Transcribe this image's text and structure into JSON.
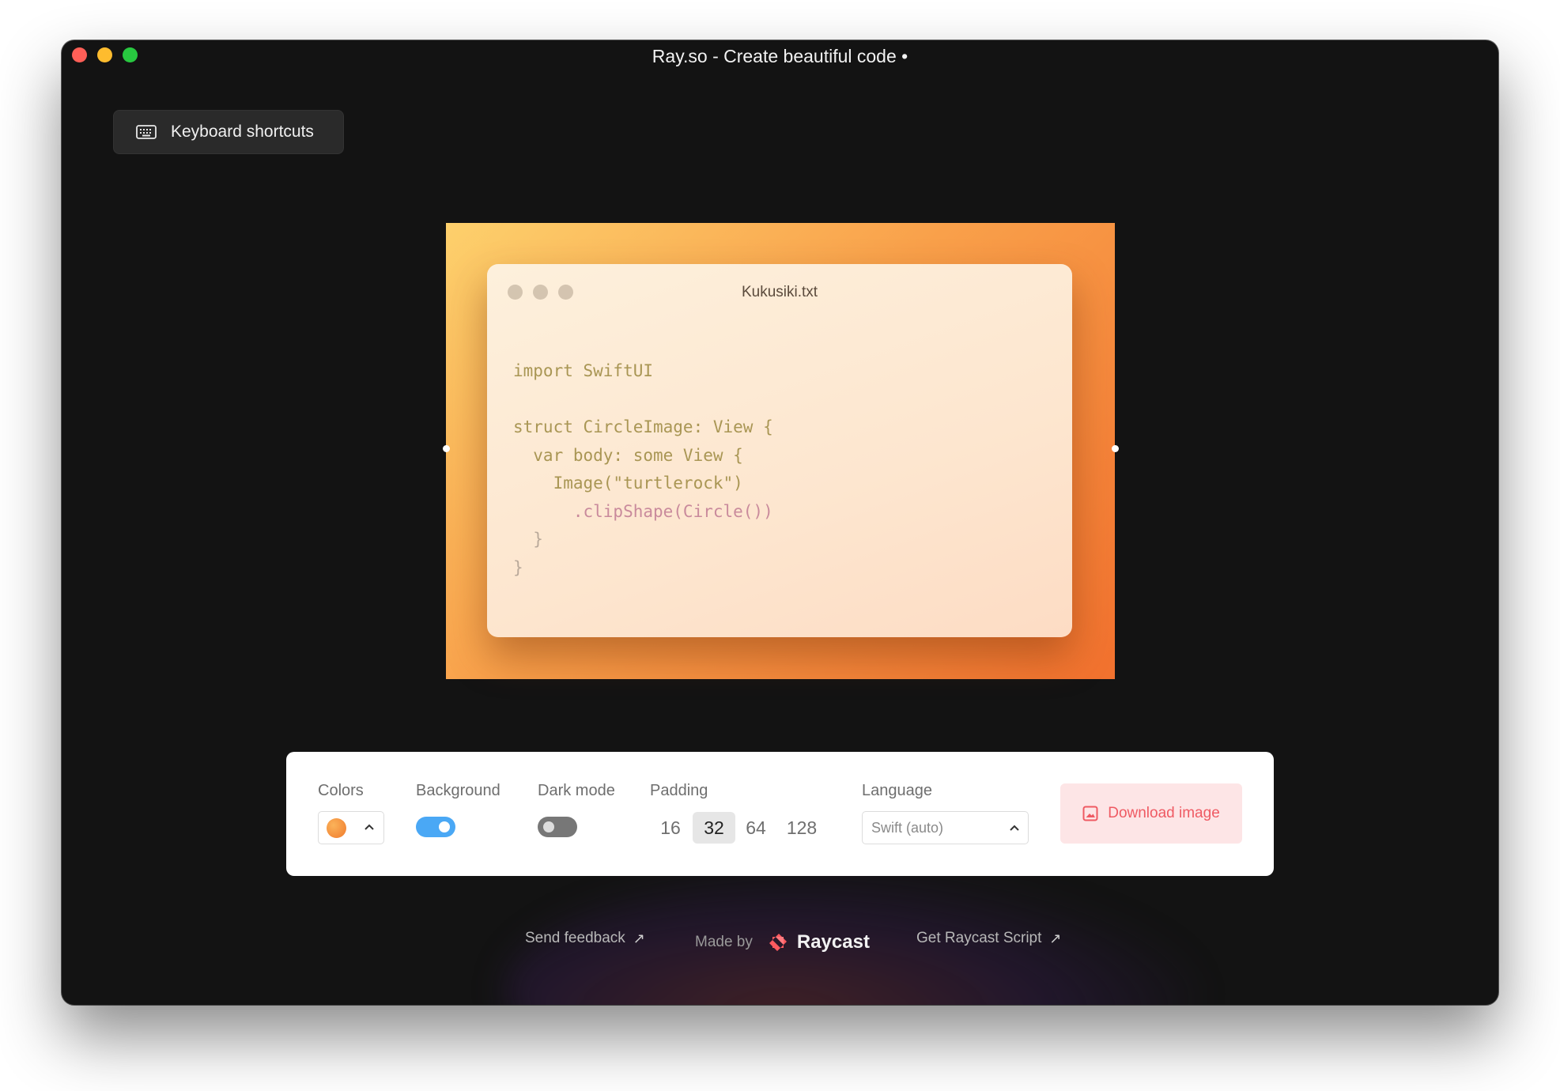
{
  "window": {
    "title": "Ray.so - Create beautiful code  •",
    "traffic_colors": [
      "#fe5f57",
      "#febc2e",
      "#28c840"
    ]
  },
  "keyboard_shortcuts": {
    "label": "Keyboard shortcuts",
    "icon": "keyboard-icon"
  },
  "preview": {
    "filename": "Kukusiki.txt",
    "code_lines": [
      "import SwiftUI",
      "",
      "struct CircleImage: View {",
      "  var body: some View {",
      "    Image(\"turtlerock\")",
      "      .clipShape(Circle())",
      "  }",
      "}"
    ],
    "gradient_colors": [
      "#fdd06c",
      "#f9a04a",
      "#f2712e"
    ]
  },
  "toolbar": {
    "colors_label": "Colors",
    "colors_value": "#f39a3c",
    "background_label": "Background",
    "background_on": true,
    "darkmode_label": "Dark mode",
    "darkmode_on": false,
    "padding_label": "Padding",
    "padding_options": [
      "16",
      "32",
      "64",
      "128"
    ],
    "padding_selected": "32",
    "language_label": "Language",
    "language_value": "Swift (auto)",
    "download_label": "Download image",
    "accent": "#4aa8f5"
  },
  "footer": {
    "feedback": "Send feedback",
    "made_by": "Made by",
    "raycast": "Raycast",
    "script": "Get Raycast Script"
  }
}
